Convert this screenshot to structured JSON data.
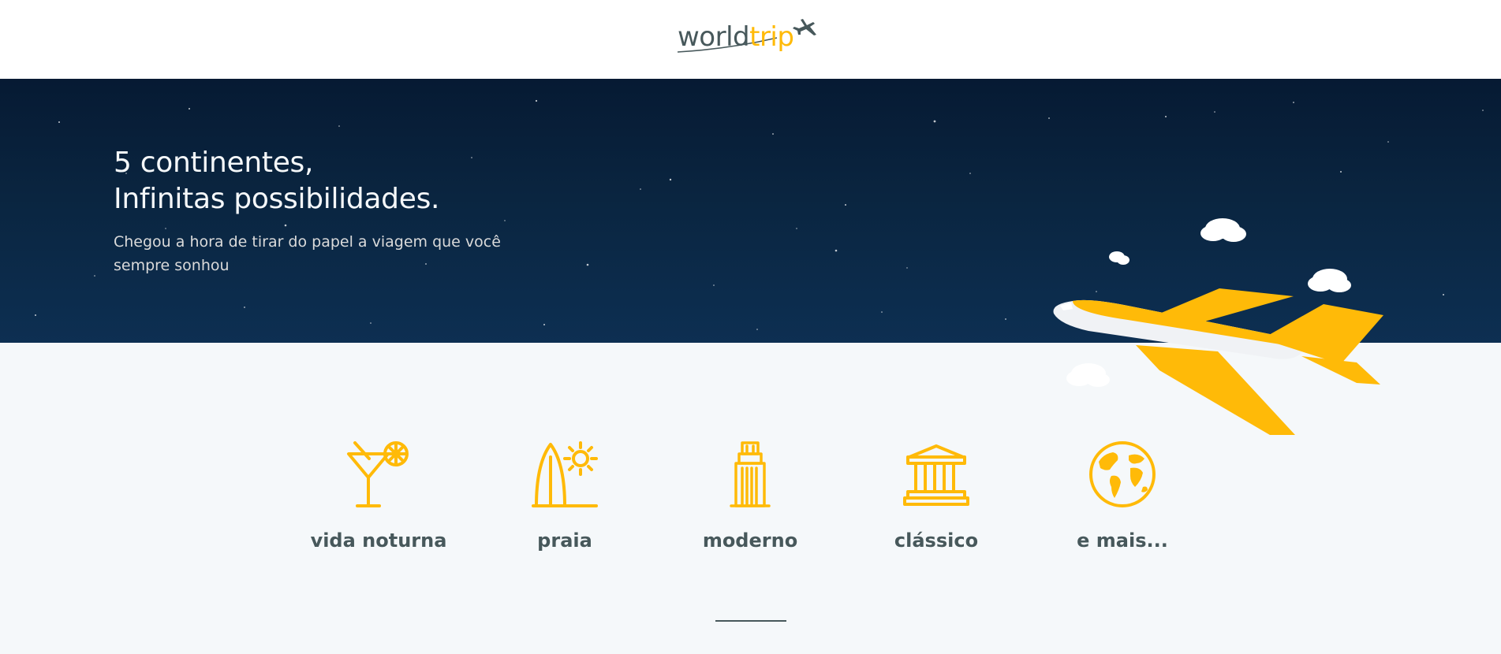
{
  "header": {
    "logo_world": "world",
    "logo_trip": "trip"
  },
  "hero": {
    "title_line1": "5 continentes,",
    "title_line2": "Infinitas possibilidades.",
    "subtitle": "Chegou a hora de tirar do papel a viagem que você sempre sonhou"
  },
  "travel_types": [
    {
      "label": "vida noturna",
      "icon": "cocktail-icon"
    },
    {
      "label": "praia",
      "icon": "surfboard-sun-icon"
    },
    {
      "label": "moderno",
      "icon": "skyscraper-icon"
    },
    {
      "label": "clássico",
      "icon": "classical-building-icon"
    },
    {
      "label": "e mais...",
      "icon": "globe-icon"
    }
  ],
  "colors": {
    "accent": "#FFBA08",
    "text": "#47585B",
    "background": "#F5F8FA",
    "hero_dark": "#061a33"
  }
}
